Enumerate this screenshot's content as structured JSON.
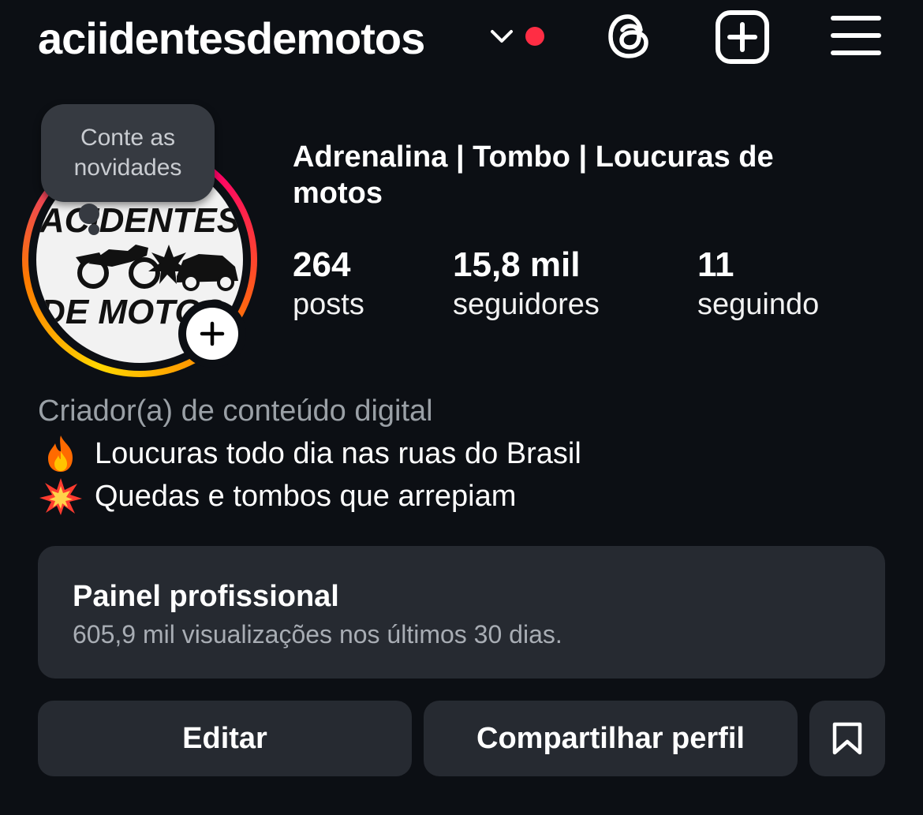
{
  "header": {
    "username": "aciidentesdemotos",
    "icons": [
      "chevron-down-icon",
      "notification-dot",
      "threads-icon",
      "plus-square-icon",
      "hamburger-menu-icon"
    ],
    "notification_color": "#ff2d44"
  },
  "note": {
    "line1": "Conte as",
    "line2": "novidades"
  },
  "avatar": {
    "logo_text_top": "ACIDENTES",
    "logo_text_bottom": "DE MOTOS"
  },
  "profile": {
    "display_name": "Adrenalina | Tombo | Loucuras de motos",
    "stats": [
      {
        "value": "264",
        "label": "posts"
      },
      {
        "value": "15,8 mil",
        "label": "seguidores"
      },
      {
        "value": "11",
        "label": "seguindo"
      }
    ],
    "category": "Criador(a) de conteúdo digital",
    "bio": [
      {
        "icon": "fire-emoji-icon",
        "text": "Loucuras todo dia nas ruas do Brasil"
      },
      {
        "icon": "collision-emoji-icon",
        "text": "Quedas e tombos que arrepiam"
      }
    ]
  },
  "professional_panel": {
    "title": "Painel profissional",
    "subtitle": "605,9 mil visualizações nos últimos 30 dias."
  },
  "buttons": {
    "edit": "Editar",
    "share": "Compartilhar perfil",
    "saved_icon": "bookmark-icon"
  },
  "colors": {
    "background": "#0c0f14",
    "surface": "#262a31",
    "muted_text": "#9aa0a6"
  }
}
